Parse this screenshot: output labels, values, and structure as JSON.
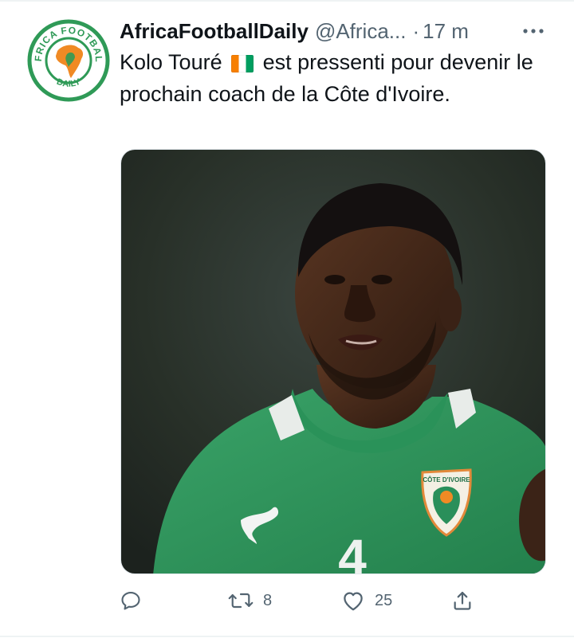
{
  "tweet": {
    "author": {
      "display_name": "AfricaFootballDaily",
      "handle": "@Africa...",
      "avatar_text_top": "AFRICA FOOTBALL",
      "avatar_text_bottom": "DAILY"
    },
    "separator": "·",
    "time": "17 m",
    "text_before_flag": "Kolo Touré",
    "flag_icon": "flag-cote-divoire",
    "text_after_flag": "est pressenti pour devenir le prochain coach de la Côte d'Ivoire.",
    "photo": {
      "badge_text": "CÔTE D'IVOIRE",
      "shirt_number": "4"
    },
    "actions": {
      "reply_icon": "reply-icon",
      "retweet_count": "8",
      "like_count": "25",
      "share_icon": "share-icon"
    }
  },
  "colors": {
    "text_primary": "#0f1419",
    "text_secondary": "#536471",
    "jersey_green": "#2e8f58",
    "flag_orange": "#f77f00",
    "flag_green": "#009e60"
  }
}
